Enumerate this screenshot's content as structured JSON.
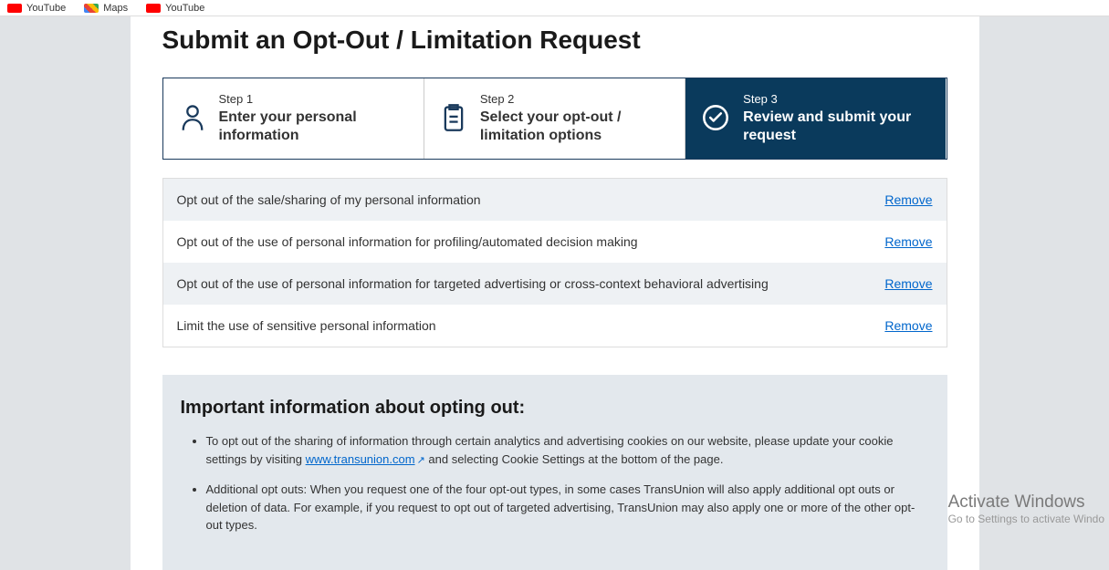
{
  "bookmarks": [
    {
      "label": "YouTube",
      "iconClass": "youtube"
    },
    {
      "label": "Maps",
      "iconClass": "maps"
    },
    {
      "label": "YouTube",
      "iconClass": "youtube"
    }
  ],
  "page": {
    "title": "Submit an Opt-Out / Limitation Request"
  },
  "steps": [
    {
      "label": "Step 1",
      "title": "Enter your personal information"
    },
    {
      "label": "Step 2",
      "title": "Select your opt-out / limitation options"
    },
    {
      "label": "Step 3",
      "title": "Review and submit your request"
    }
  ],
  "options": [
    {
      "text": "Opt out of the sale/sharing of my personal information",
      "action": "Remove"
    },
    {
      "text": "Opt out of the use of personal information for profiling/automated decision making",
      "action": "Remove"
    },
    {
      "text": "Opt out of the use of personal information for targeted advertising or cross-context behavioral advertising",
      "action": "Remove"
    },
    {
      "text": "Limit the use of sensitive personal information",
      "action": "Remove"
    }
  ],
  "info": {
    "title": "Important information about opting out:",
    "link_text": "www.transunion.com",
    "bullet1_a": "To opt out of the sharing of information through certain analytics and advertising cookies on our website, please update your cookie settings by visiting ",
    "bullet1_b": " and selecting Cookie Settings at the bottom of the page.",
    "bullet2": "Additional opt outs: When you request one of the four opt-out types, in some cases TransUnion will also apply additional opt outs or deletion of data. For example, if you request to opt out of targeted advertising, TransUnion may also apply one or more of the other opt-out types."
  },
  "watermark": {
    "title": "Activate Windows",
    "sub": "Go to Settings to activate Windo"
  }
}
